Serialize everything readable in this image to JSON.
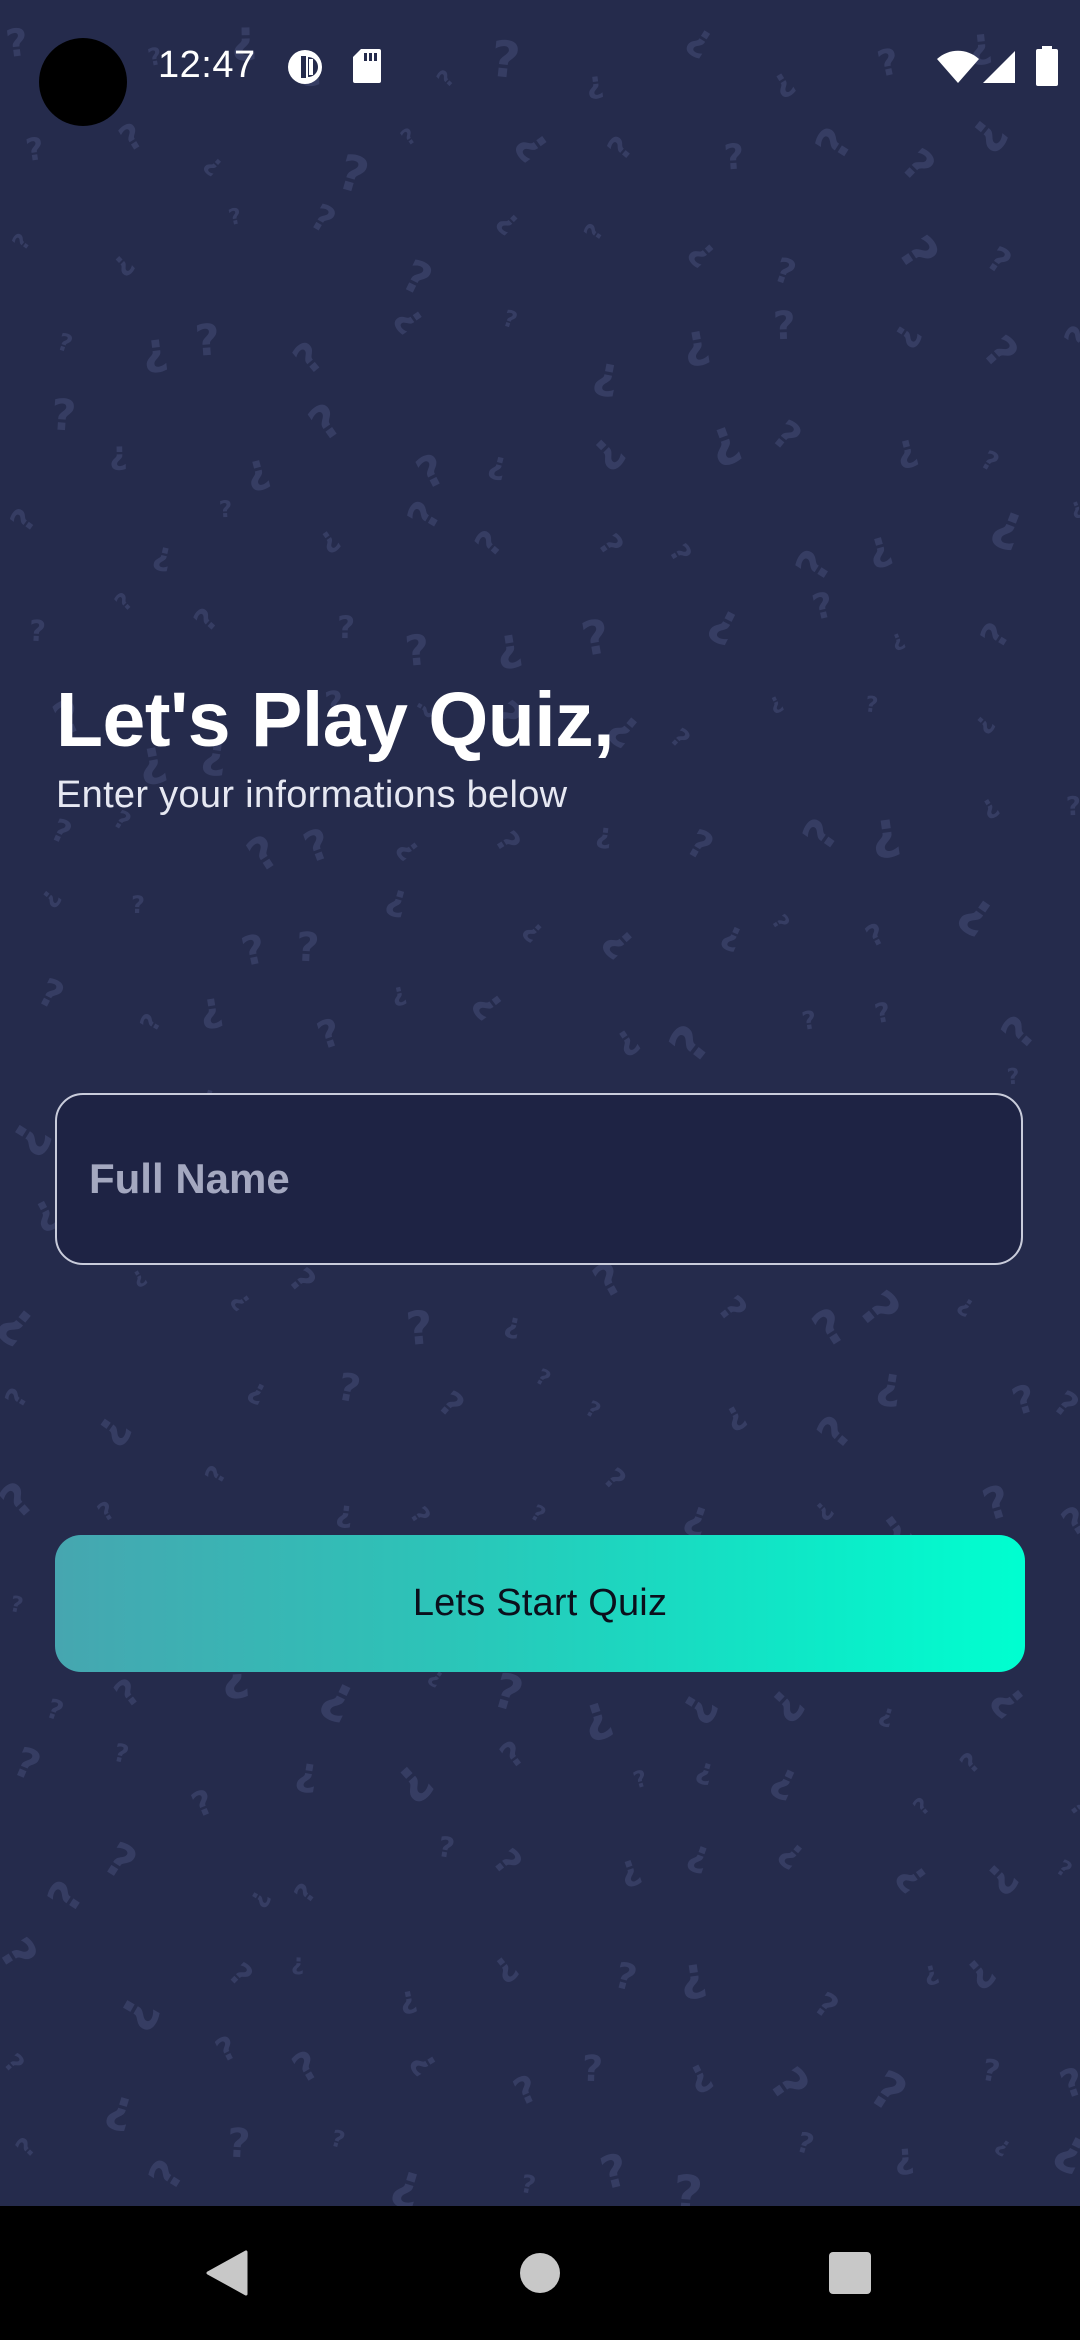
{
  "status_bar": {
    "time": "12:47",
    "left_icons": [
      "data-saver-icon",
      "sd-card-icon"
    ],
    "right_icons": [
      "wifi-icon",
      "cell-signal-icon",
      "battery-icon"
    ]
  },
  "header": {
    "title": "Let's Play Quiz,",
    "subtitle": "Enter your informations below"
  },
  "form": {
    "name_value": "",
    "name_placeholder": "Full Name"
  },
  "actions": {
    "start_label": "Lets Start Quiz"
  },
  "nav_bar": {
    "buttons": [
      "back-icon",
      "home-icon",
      "recents-icon"
    ]
  },
  "colors": {
    "background": "#252b4c",
    "pattern": "#363d63",
    "field_background": "#1e2344",
    "field_border": "#c9ccdb",
    "button_gradient_start": "#46a6b0",
    "button_gradient_end": "#00ffd0",
    "button_text": "#0b0f1c"
  }
}
